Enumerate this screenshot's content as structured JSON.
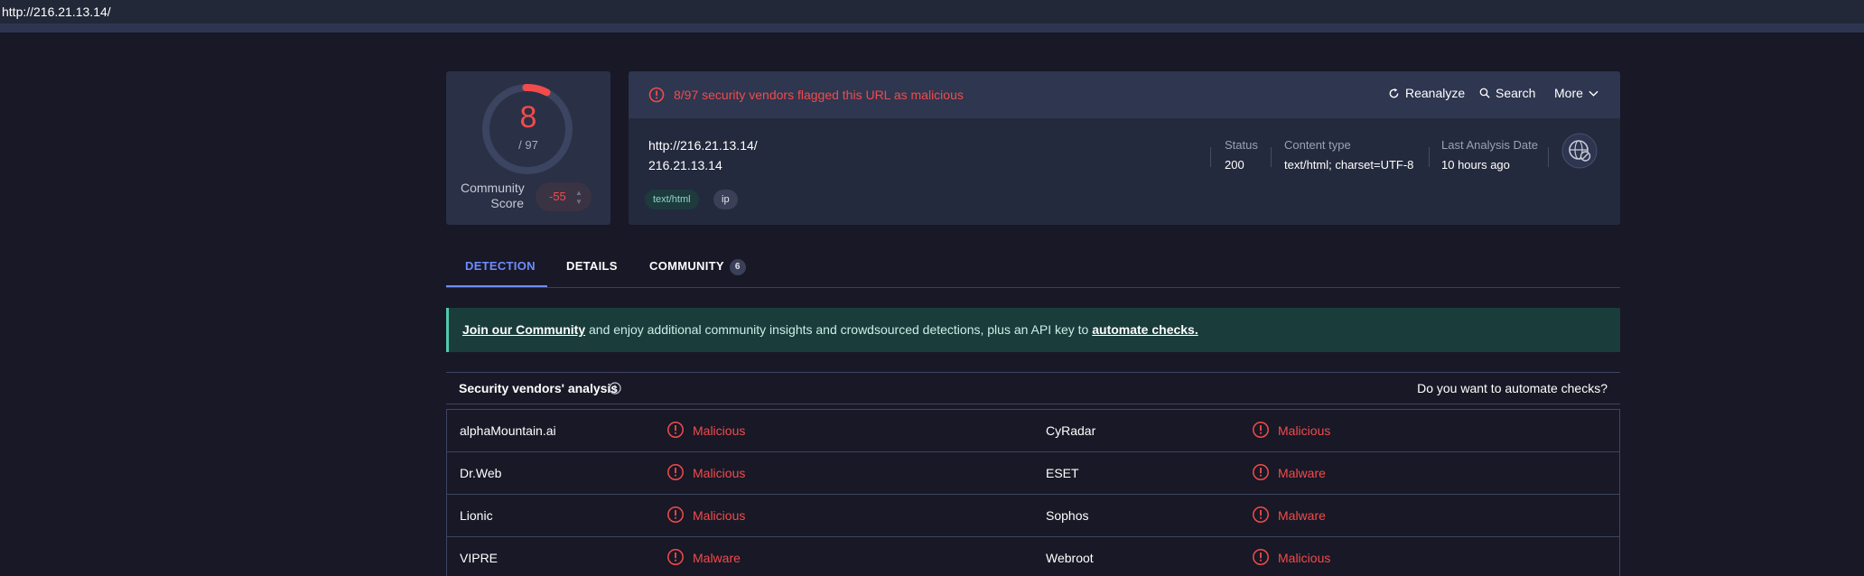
{
  "browser": {
    "url": "http://216.21.13.14/"
  },
  "score": {
    "detected": "8",
    "total": "/ 97",
    "community_label": "Community Score",
    "community_value": "-55"
  },
  "header": {
    "alert": "8/97 security vendors flagged this URL as malicious",
    "reanalyze": "Reanalyze",
    "search": "Search",
    "more": "More"
  },
  "info": {
    "url": "http://216.21.13.14/",
    "host": "216.21.13.14",
    "tags": [
      "text/html",
      "ip"
    ],
    "status_label": "Status",
    "status_value": "200",
    "content_type_label": "Content type",
    "content_type_value": "text/html; charset=UTF-8",
    "last_analysis_label": "Last Analysis Date",
    "last_analysis_value": "10 hours ago"
  },
  "tabs": [
    {
      "label": "DETECTION",
      "active": true
    },
    {
      "label": "DETAILS",
      "active": false
    },
    {
      "label": "COMMUNITY",
      "badge": "6",
      "active": false
    }
  ],
  "banner": {
    "link1": "Join our Community",
    "middle": " and enjoy additional community insights and crowdsourced detections, plus an API key to ",
    "link2": "automate checks."
  },
  "vendors": {
    "title": "Security vendors' analysis",
    "automate": "Do you want to automate checks?",
    "rows": [
      {
        "left": {
          "name": "alphaMountain.ai",
          "result": "Malicious"
        },
        "right": {
          "name": "CyRadar",
          "result": "Malicious"
        }
      },
      {
        "left": {
          "name": "Dr.Web",
          "result": "Malicious"
        },
        "right": {
          "name": "ESET",
          "result": "Malware"
        }
      },
      {
        "left": {
          "name": "Lionic",
          "result": "Malicious"
        },
        "right": {
          "name": "Sophos",
          "result": "Malware"
        }
      },
      {
        "left": {
          "name": "VIPRE",
          "result": "Malware"
        },
        "right": {
          "name": "Webroot",
          "result": "Malicious"
        }
      }
    ]
  },
  "colors": {
    "danger": "#f24b4b",
    "accent": "#6f8cff",
    "teal": "#53c7ad"
  }
}
